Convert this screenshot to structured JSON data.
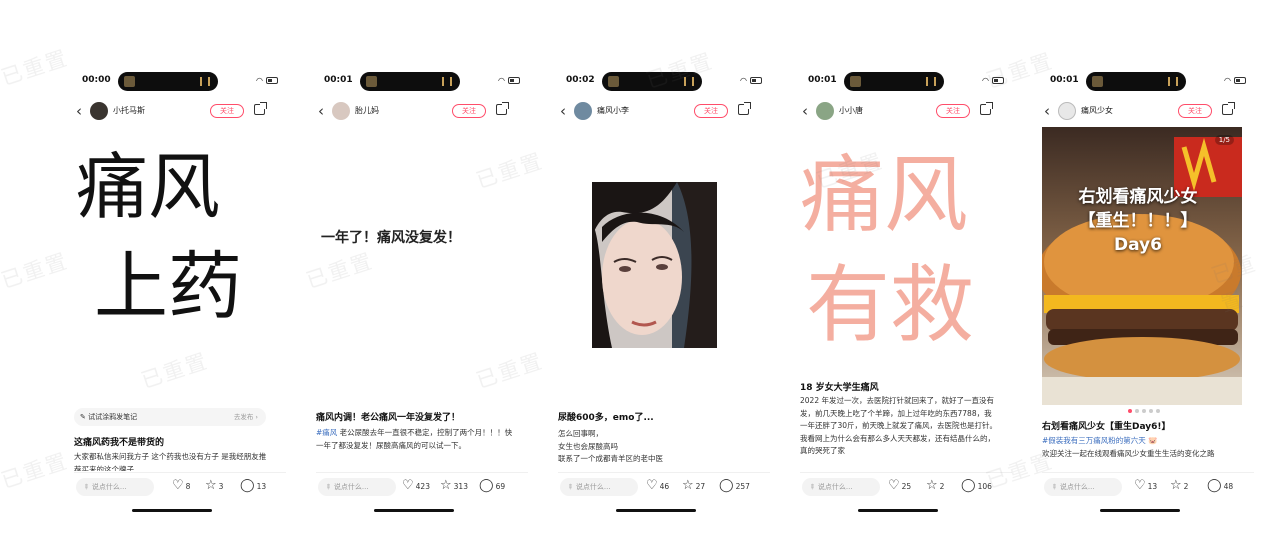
{
  "accent_color": "#ff4d6a",
  "follow_label": "关注",
  "comment_placeholder": "说点什么...",
  "watermark": "已重置",
  "icons": {
    "like": "heart-icon",
    "collect": "star-icon",
    "comment": "comment-icon",
    "share": "share-icon",
    "back": "back-arrow-icon"
  },
  "phones": [
    {
      "time": "00:00",
      "user": "小托马斯",
      "cover_line1": "痛风",
      "cover_line2": "上药",
      "ai_banner": "试试涂鸦发笔记",
      "ai_banner_action": "去发布 ›",
      "title": "这痛风药我不是带货的",
      "desc": "大家都私信来问我方子 这个药我也没有方子 是我经朋友推荐买来的这个牌子",
      "likes": "8",
      "collects": "3",
      "comments": "13"
    },
    {
      "time": "00:01",
      "user": "胎儿妈",
      "cover_text": "一年了！痛风没复发！",
      "title": "痛风内调！老公痛风一年没复发了！",
      "tag": "#痛风",
      "desc": " 老公尿酸去年一直很不稳定，控制了两个月！！！快一年了都没复发！尿酸高痛风的可以试一下。",
      "likes": "423",
      "collects": "313",
      "comments": "69"
    },
    {
      "time": "00:02",
      "user": "痛风小李",
      "title": "尿酸600多，emo了...",
      "desc_lines": [
        "怎么回事啊，",
        "女生也会尿酸高吗",
        "联系了一个成都青羊区的老中医"
      ],
      "likes": "46",
      "collects": "27",
      "comments": "257"
    },
    {
      "time": "00:01",
      "user": "小小唐",
      "cover_line1": "痛风",
      "cover_line2": "有救",
      "title": "18 岁女大学生痛风",
      "desc": "2022 年发过一次，去医院打针就回来了，就好了一直没有发，前几天晚上吃了个羊蹄，加上过年吃的东西7788，我一年还胖了30斤，前天晚上就发了痛风，去医院也是打针。我看网上为什么会有那么多人天天都发，还有结晶什么的，真的哭死了家",
      "likes": "25",
      "collects": "2",
      "comments": "106"
    },
    {
      "time": "00:01",
      "user": "痛风少女",
      "page_counter": "1/5",
      "cover_line1": "右划看痛风少女",
      "cover_line2": "【重生！！！】",
      "cover_line3": "Day6",
      "title": "右划看痛风少女【重生Day6!】",
      "tag": "#假装我有三万痛风粉的第六天",
      "desc": "欢迎关注一起在线观看痛风少女重生生活的变化之路",
      "likes": "13",
      "collects": "2",
      "comments": "48"
    }
  ]
}
